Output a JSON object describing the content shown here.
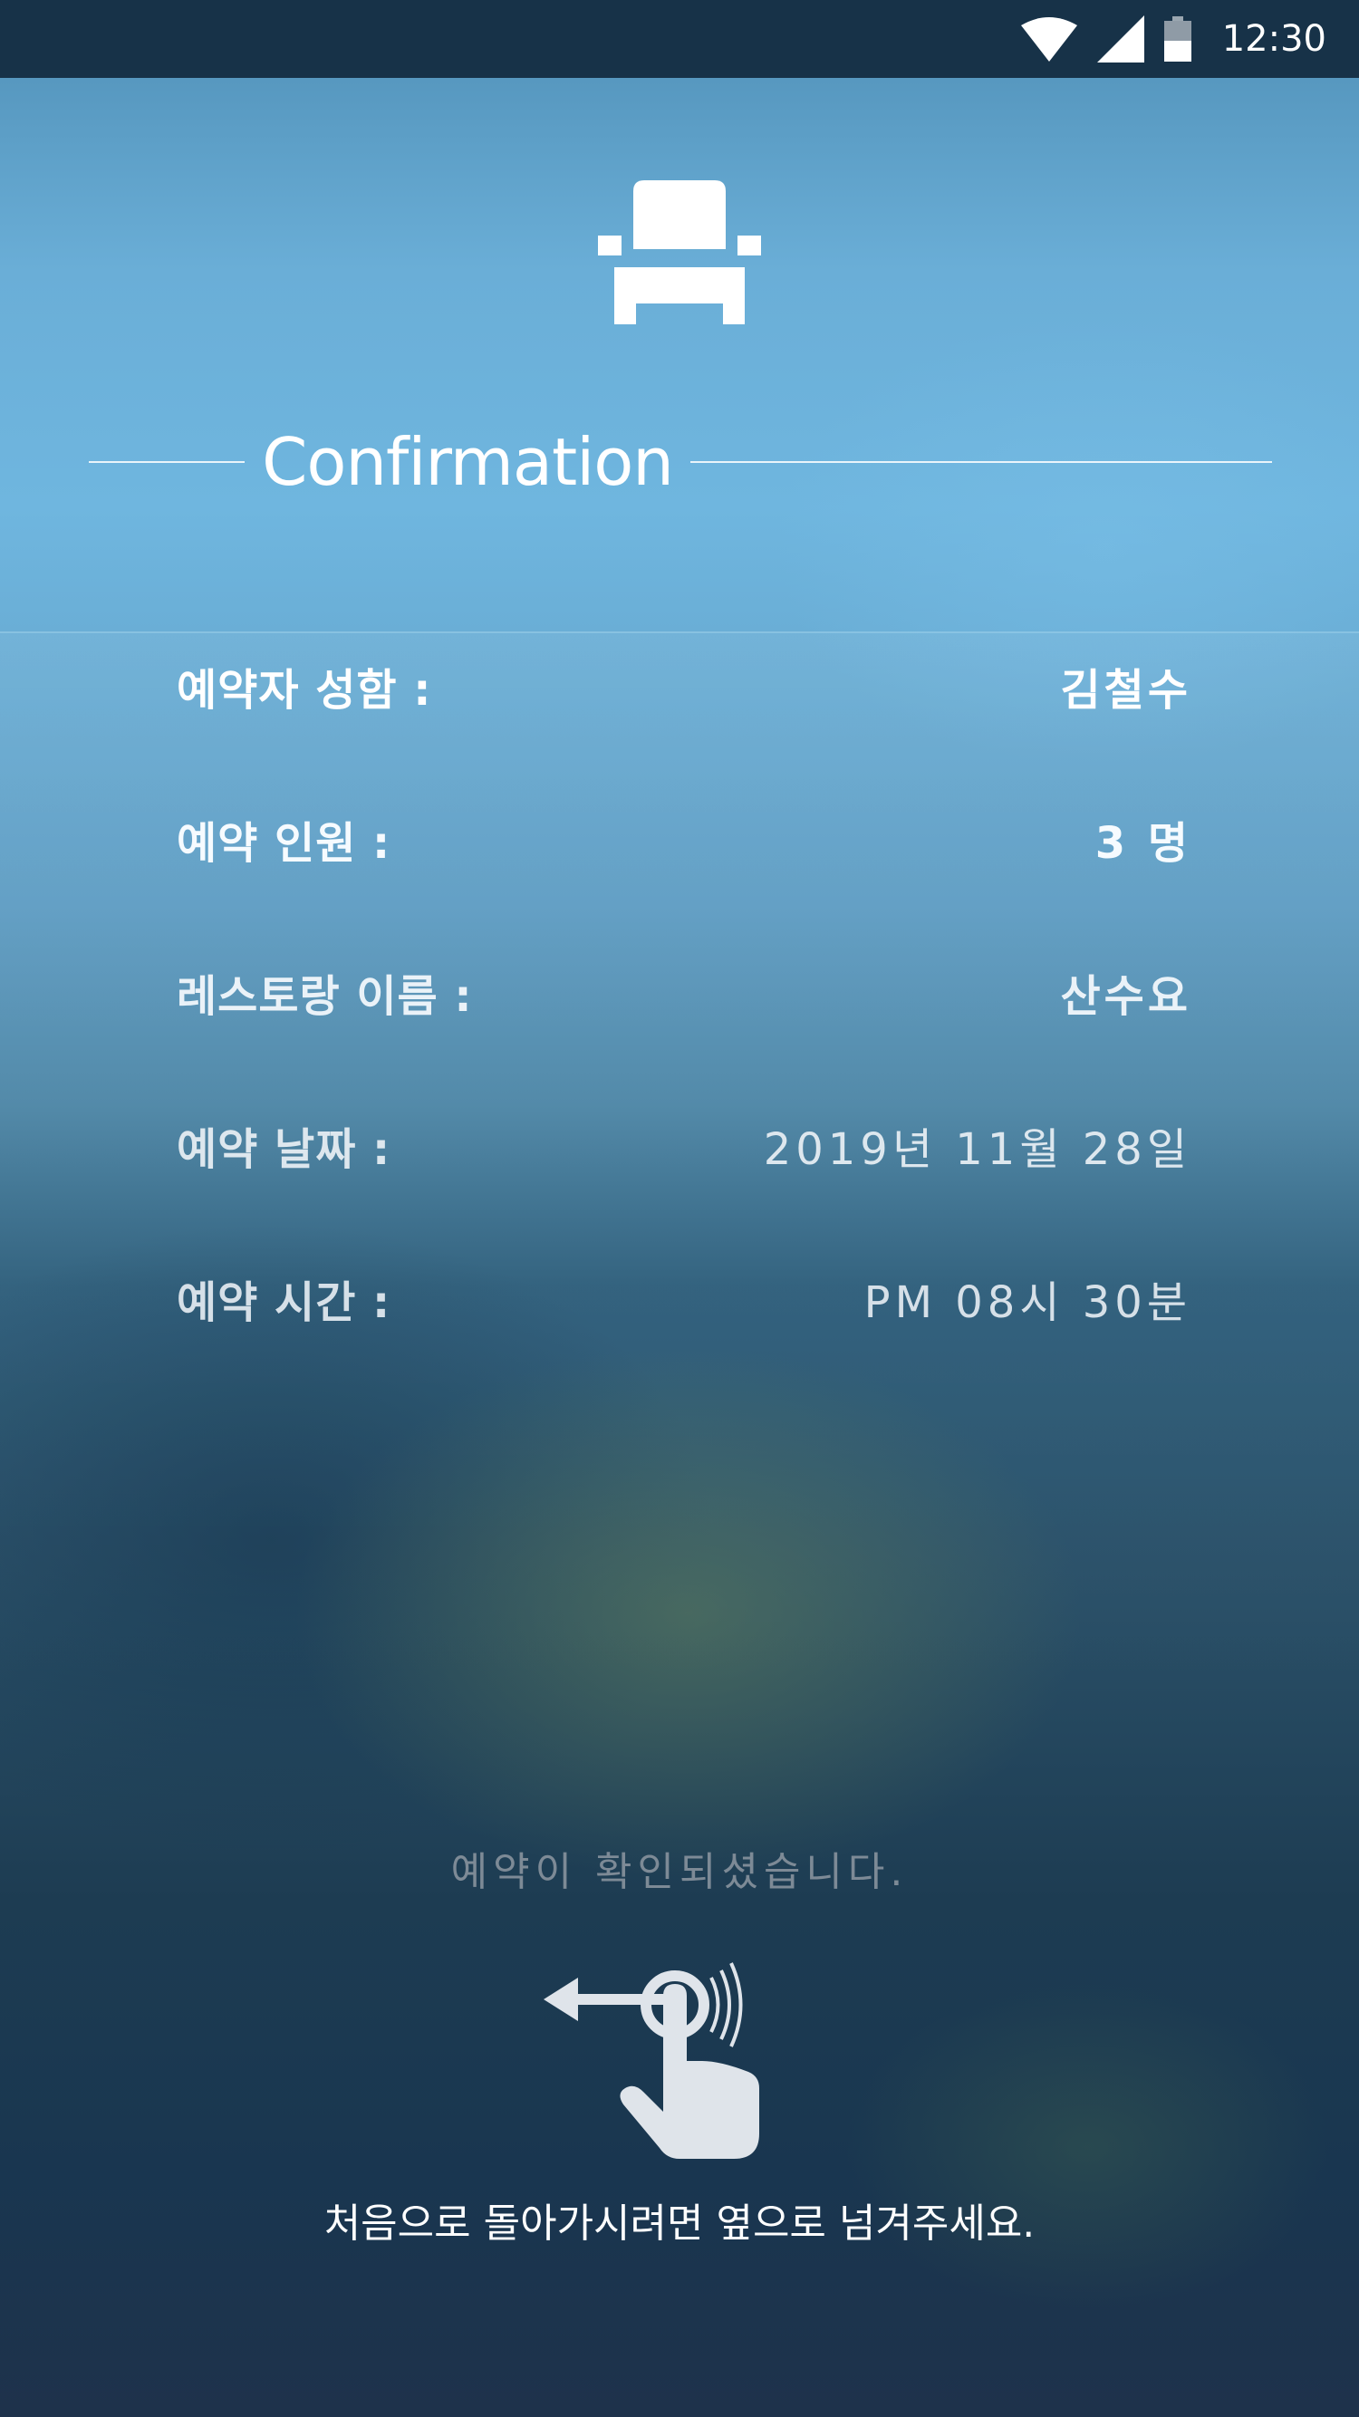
{
  "status_bar": {
    "time": "12:30",
    "icons": [
      "wifi-icon",
      "cell-signal-icon",
      "battery-icon"
    ]
  },
  "header": {
    "icon": "chair-icon",
    "title": "Confirmation"
  },
  "details": [
    {
      "label": "예약자 성함 :",
      "value": "김철수"
    },
    {
      "label": "예약 인원 :",
      "value": "3 명"
    },
    {
      "label": "레스토랑 이름 :",
      "value": "산수요"
    },
    {
      "label": "예약 날짜 :",
      "value": "2019년 11월 28일"
    },
    {
      "label": "예약 시간 :",
      "value": "PM 08시 30분"
    }
  ],
  "footer": {
    "confirm_message": "예약이 확인되셨습니다.",
    "swipe_icon": "swipe-left-hand-icon",
    "swipe_message": "처음으로 돌아가시려면 옆으로 넘겨주세요."
  },
  "colors": {
    "status_bar": "#173248",
    "sky_top": "#6fb6df",
    "bottom": "#1d3c52",
    "text_primary": "#ffffff",
    "text_muted": "#7d8a96",
    "icon_fill": "#dfe4ea"
  }
}
